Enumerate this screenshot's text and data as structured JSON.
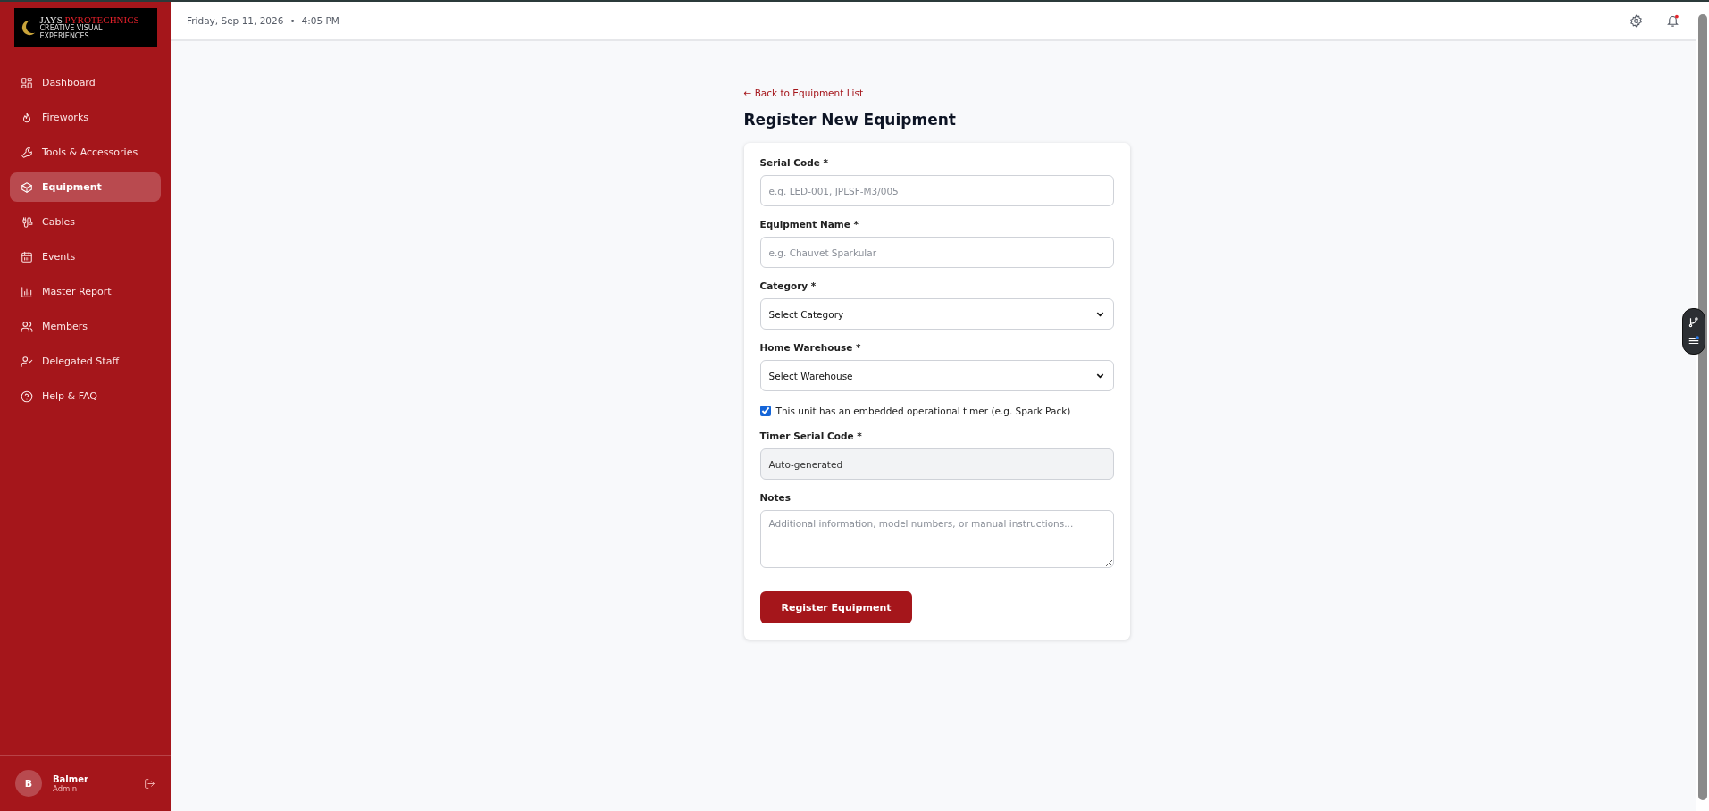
{
  "sidebar": {
    "logo": {
      "name_part_1": "JAYS",
      "name_part_2": "PYROTECHNICS",
      "tagline": "CREATIVE VISUAL EXPERIENCES"
    },
    "items": [
      {
        "label": "Dashboard",
        "kind": "grid",
        "selected": false
      },
      {
        "label": "Fireworks",
        "kind": "flame",
        "selected": false
      },
      {
        "label": "Tools & Accessories",
        "kind": "wrench",
        "selected": false
      },
      {
        "label": "Equipment",
        "kind": "box",
        "selected": true
      },
      {
        "label": "Cables",
        "kind": "cable",
        "selected": false
      },
      {
        "label": "Events",
        "kind": "calendar",
        "selected": false
      },
      {
        "label": "Master Report",
        "kind": "chart",
        "selected": false
      },
      {
        "label": "Members",
        "kind": "users",
        "selected": false
      },
      {
        "label": "Delegated Staff",
        "kind": "usercheck",
        "selected": false
      },
      {
        "label": "Help & FAQ",
        "kind": "help",
        "selected": false
      }
    ],
    "user": {
      "initial": "B",
      "name": "Balmer",
      "role": "Admin"
    }
  },
  "header": {
    "date": "Friday, Sep 11, 2026",
    "separator": "•",
    "time": "4:05 PM",
    "notification_unread": true
  },
  "back_link": "← Back to Equipment List",
  "title": "Register New Equipment",
  "form": {
    "fields": [
      {
        "kind": "input",
        "label": "Serial Code *",
        "placeholder": "e.g. LED-001, JPLSF-M3/005"
      },
      {
        "kind": "input",
        "label": "Equipment Name *",
        "placeholder": "e.g. Chauvet Sparkular"
      },
      {
        "kind": "select",
        "label": "Category *",
        "value": "Select Category"
      },
      {
        "kind": "select",
        "label": "Home Warehouse *",
        "value": "Select Warehouse"
      },
      {
        "kind": "checkbox",
        "label": "This unit has an embedded operational timer (e.g. Spark Pack)",
        "checked": true
      },
      {
        "kind": "readonly",
        "label": "Timer Serial Code *",
        "value": "Auto-generated"
      },
      {
        "kind": "textarea",
        "label": "Notes",
        "placeholder": "Additional information, model numbers, or manual instructions..."
      }
    ],
    "submit": "Register Equipment"
  }
}
